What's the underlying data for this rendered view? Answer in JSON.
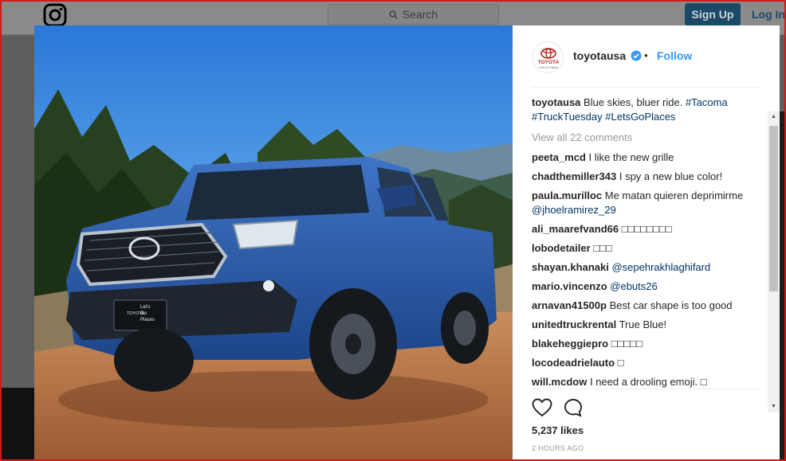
{
  "header": {
    "search_placeholder": "Search",
    "signup_label": "Sign Up",
    "login_label": "Log In"
  },
  "post": {
    "username": "toyotausa",
    "follow_label": "Follow",
    "separator": "•",
    "avatar_brand": "TOYOTA",
    "avatar_tagline": "Let's Go Places",
    "plate_brand": "TOYOTA",
    "plate_text": [
      "Let's",
      "Go",
      "Places"
    ],
    "caption": {
      "user": "toyotausa",
      "text": "Blue skies, bluer ride.",
      "tags": [
        "#Tacoma",
        "#TruckTuesday",
        "#LetsGoPlaces"
      ]
    },
    "view_all": "View all 22 comments",
    "comments": [
      {
        "user": "peeta_mcd",
        "text": "I like the new grille"
      },
      {
        "user": "chadthemiller343",
        "text": "I spy a new blue color!"
      },
      {
        "user": "paula.murilloc",
        "text": "Me matan quieren deprimirme",
        "mention": "@jhoelramirez_29"
      },
      {
        "user": "ali_maarefvand66",
        "text": "□□□□□□□□"
      },
      {
        "user": "lobodetailer",
        "text": "□□□"
      },
      {
        "user": "shayan.khanaki",
        "text": "",
        "mention": "@sepehrakhlaghifard"
      },
      {
        "user": "mario.vincenzo",
        "text": "",
        "mention": "@ebuts26"
      },
      {
        "user": "arnavan41500p",
        "text": "Best car shape is too good"
      },
      {
        "user": "unitedtruckrental",
        "text": "True Blue!"
      },
      {
        "user": "blakeheggiepro",
        "text": "□□□□□"
      },
      {
        "user": "locodeadrielauto",
        "text": "□"
      },
      {
        "user": "will.mcdow",
        "text": "I need a drooling emoji. □"
      }
    ],
    "likes": "5,237 likes",
    "time": "2 HOURS AGO"
  },
  "colors": {
    "link": "#3897f0",
    "hashtag": "#003569",
    "truck_blue": "#2a5aa8"
  },
  "icons": [
    "instagram-icon",
    "search-icon",
    "verified-icon",
    "heart-icon",
    "comment-icon"
  ]
}
